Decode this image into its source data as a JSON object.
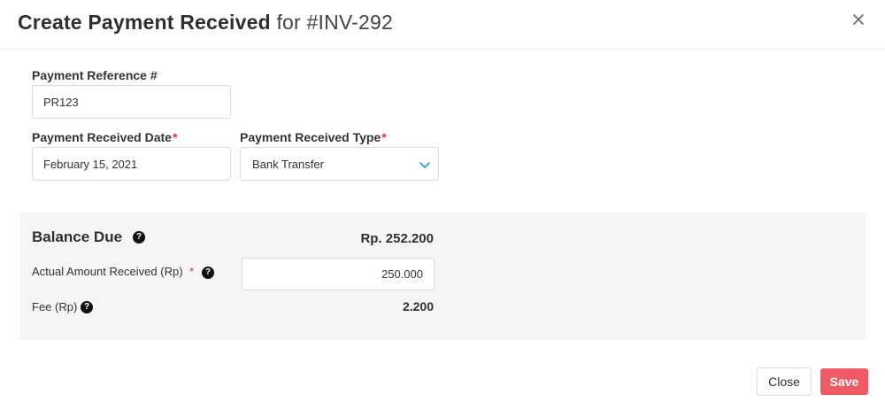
{
  "modal": {
    "title_main": "Create Payment Received",
    "title_for": "for #INV-292",
    "close_icon": "close-icon"
  },
  "form": {
    "payment_reference": {
      "label": "Payment Reference #",
      "value": "PR123"
    },
    "payment_date": {
      "label": "Payment Received Date",
      "required_mark": "*",
      "value": "February 15, 2021"
    },
    "payment_type": {
      "label": "Payment Received Type",
      "required_mark": "*",
      "value": "Bank Transfer",
      "icon": "chevron-down-icon"
    }
  },
  "balance": {
    "title": "Balance Due",
    "value": "Rp. 252.200",
    "help_icon": "help-icon",
    "actual_amount": {
      "label": "Actual Amount Received (Rp)",
      "required_mark": "*",
      "value": "250.000"
    },
    "fee": {
      "label": "Fee (Rp)",
      "value": "2.200"
    }
  },
  "footer": {
    "close_label": "Close",
    "save_label": "Save"
  },
  "colors": {
    "accent_save": "#f05a64",
    "required": "#d9363e",
    "chevron": "#2196d3",
    "panel_bg": "#f5f5f5"
  }
}
